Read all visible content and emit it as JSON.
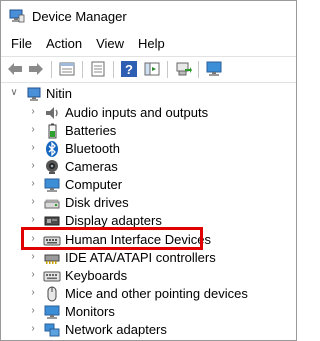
{
  "window": {
    "title": "Device Manager"
  },
  "menu": [
    "File",
    "Action",
    "View",
    "Help"
  ],
  "toolbar": {
    "icons": [
      "back-arrow-icon",
      "forward-arrow-icon",
      "properties-icon",
      "update-driver-icon",
      "help-icon",
      "action-pane-icon",
      "scan-hardware-icon",
      "monitor-icon"
    ]
  },
  "tree": {
    "root": {
      "label": "Nitin",
      "expanded": true
    },
    "items": [
      {
        "label": "Audio inputs and outputs",
        "icon": "speaker-icon"
      },
      {
        "label": "Batteries",
        "icon": "battery-icon"
      },
      {
        "label": "Bluetooth",
        "icon": "bluetooth-icon"
      },
      {
        "label": "Cameras",
        "icon": "camera-icon"
      },
      {
        "label": "Computer",
        "icon": "computer-icon"
      },
      {
        "label": "Disk drives",
        "icon": "disk-drive-icon"
      },
      {
        "label": "Display adapters",
        "icon": "display-adapter-icon"
      },
      {
        "label": "Human Interface Devices",
        "icon": "hid-icon",
        "highlighted": true
      },
      {
        "label": "IDE ATA/ATAPI controllers",
        "icon": "ide-controller-icon"
      },
      {
        "label": "Keyboards",
        "icon": "keyboard-icon"
      },
      {
        "label": "Mice and other pointing devices",
        "icon": "mouse-icon"
      },
      {
        "label": "Monitors",
        "icon": "monitor-icon"
      },
      {
        "label": "Network adapters",
        "icon": "network-adapter-icon"
      }
    ]
  },
  "colors": {
    "highlight_border": "#e00000"
  }
}
